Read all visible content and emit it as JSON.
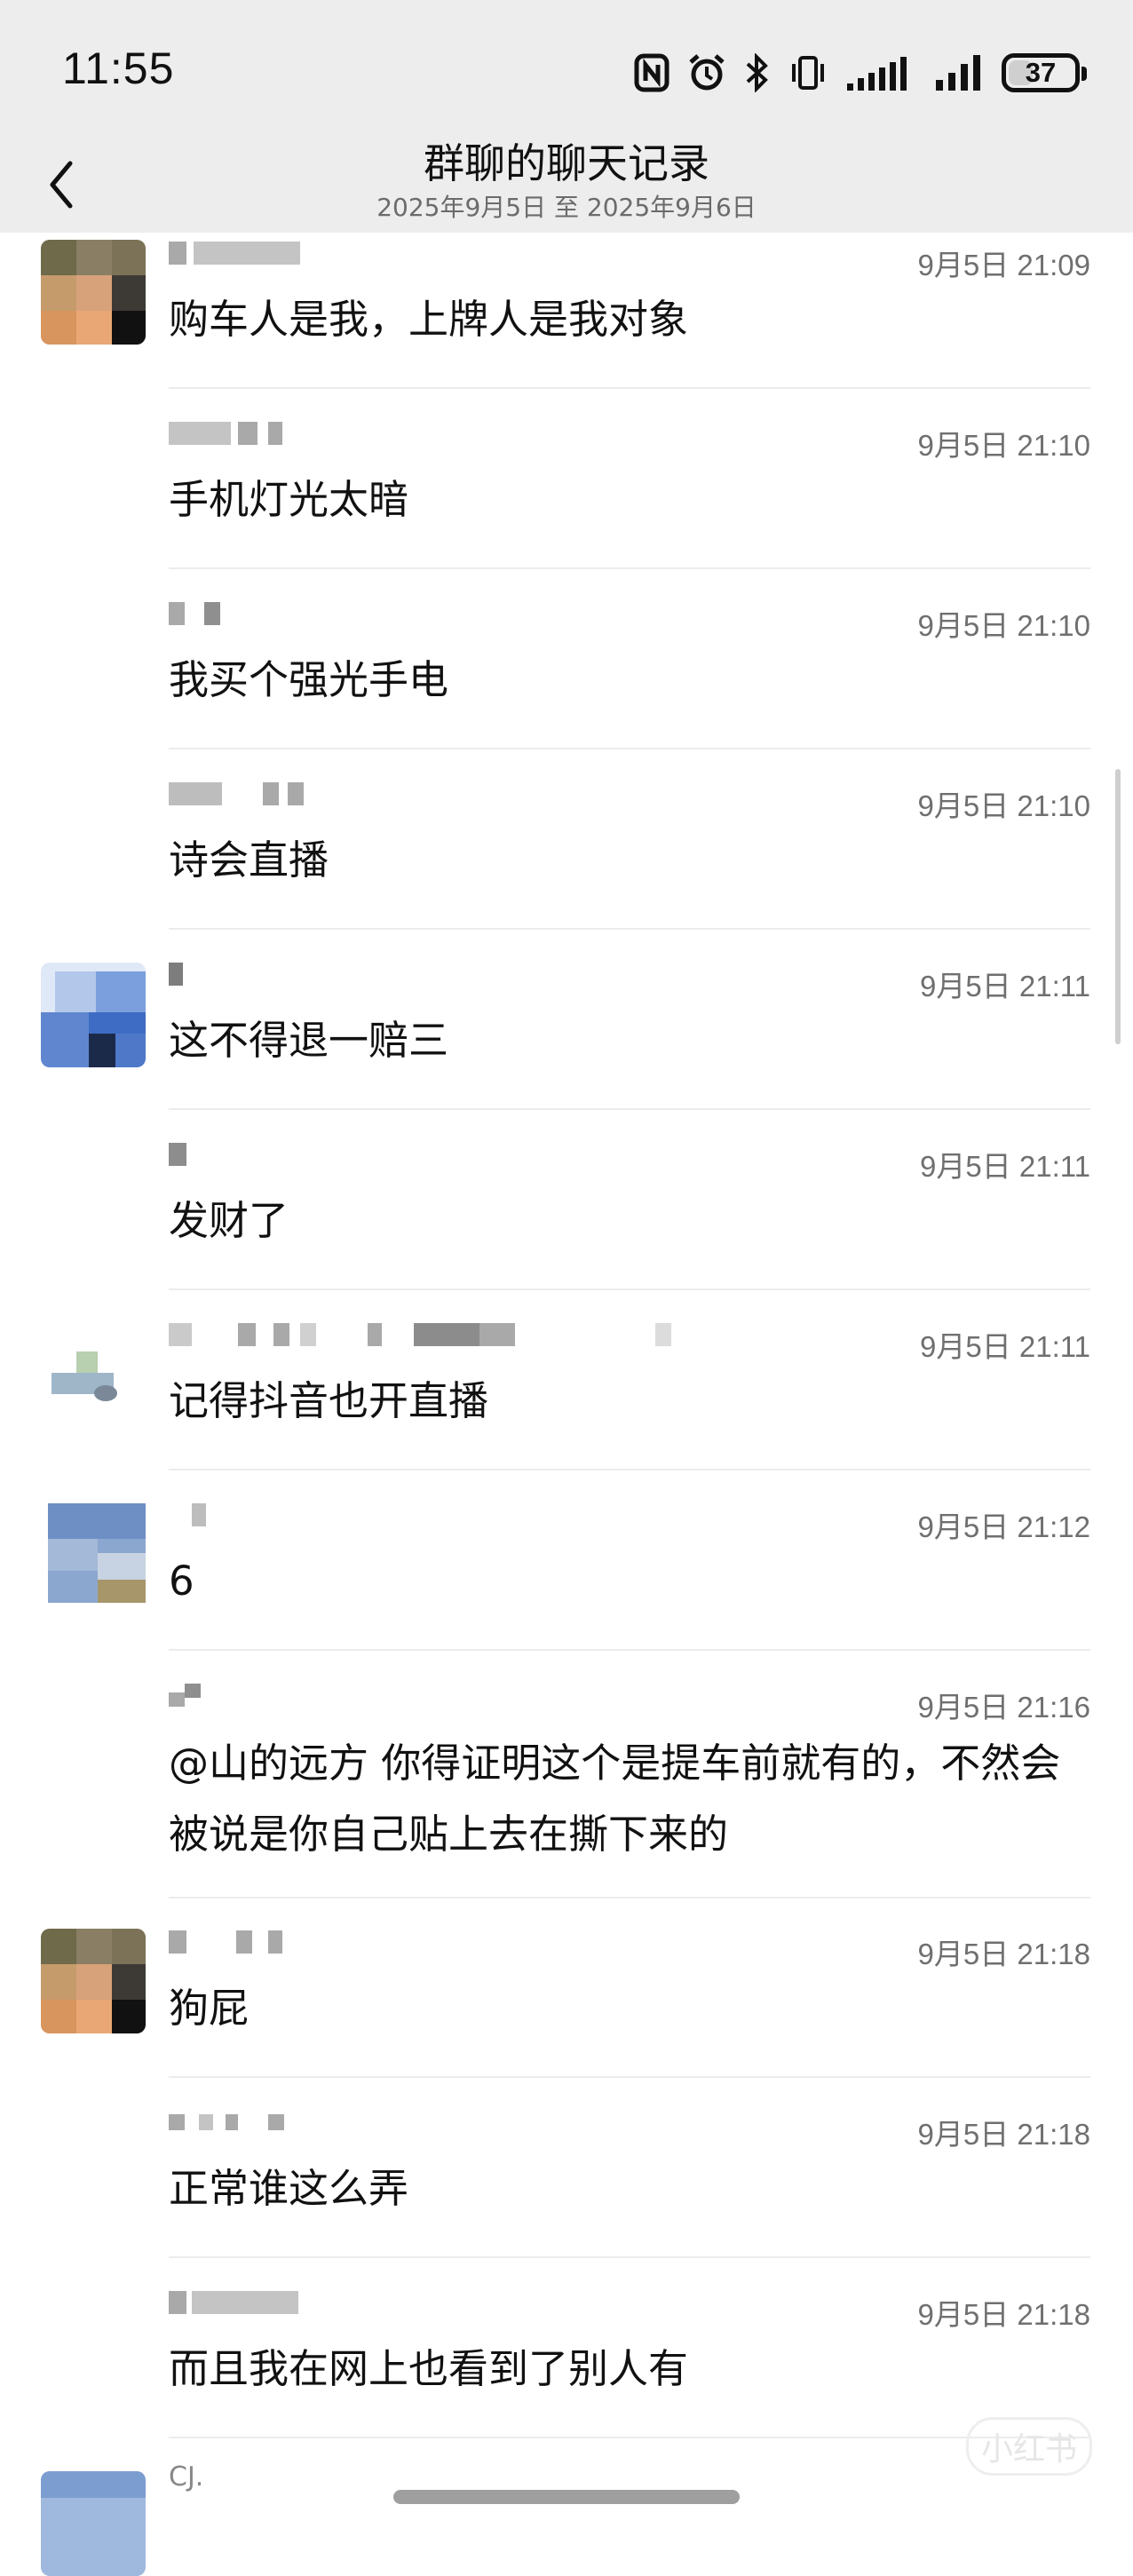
{
  "status_bar": {
    "time": "11:55",
    "battery": "37",
    "battery_level": 0.37,
    "icons": [
      "nfc-icon",
      "alarm-icon",
      "bluetooth-icon",
      "vibrate-icon",
      "signal-icon",
      "signal-icon"
    ]
  },
  "header": {
    "title": "群聊的聊天记录",
    "subtitle": "2025年9月5日 至 2025年9月6日"
  },
  "messages": [
    {
      "time": "9月5日 21:09",
      "text": "购车人是我，上牌人是我对象"
    },
    {
      "time": "9月5日 21:10",
      "text": "手机灯光太暗"
    },
    {
      "time": "9月5日 21:10",
      "text": "我买个强光手电"
    },
    {
      "time": "9月5日 21:10",
      "text": "诗会直播"
    },
    {
      "time": "9月5日 21:11",
      "text": "这不得退一赔三"
    },
    {
      "time": "9月5日 21:11",
      "text": "发财了"
    },
    {
      "time": "9月5日 21:11",
      "text": "记得抖音也开直播"
    },
    {
      "time": "9月5日 21:12",
      "text": "6"
    },
    {
      "time": "9月5日 21:16",
      "text": "@山的远方 你得证明这个是提车前就有的，不然会被说是你自己贴上去在撕下来的"
    },
    {
      "time": "9月5日 21:18",
      "text": "狗屁"
    },
    {
      "time": "9月5日 21:18",
      "text": "正常谁这么弄"
    },
    {
      "time": "9月5日 21:18",
      "text": "而且我在网上也看到了别人有"
    }
  ],
  "partial_message": {
    "name": "CJ."
  },
  "watermark": "小红书"
}
